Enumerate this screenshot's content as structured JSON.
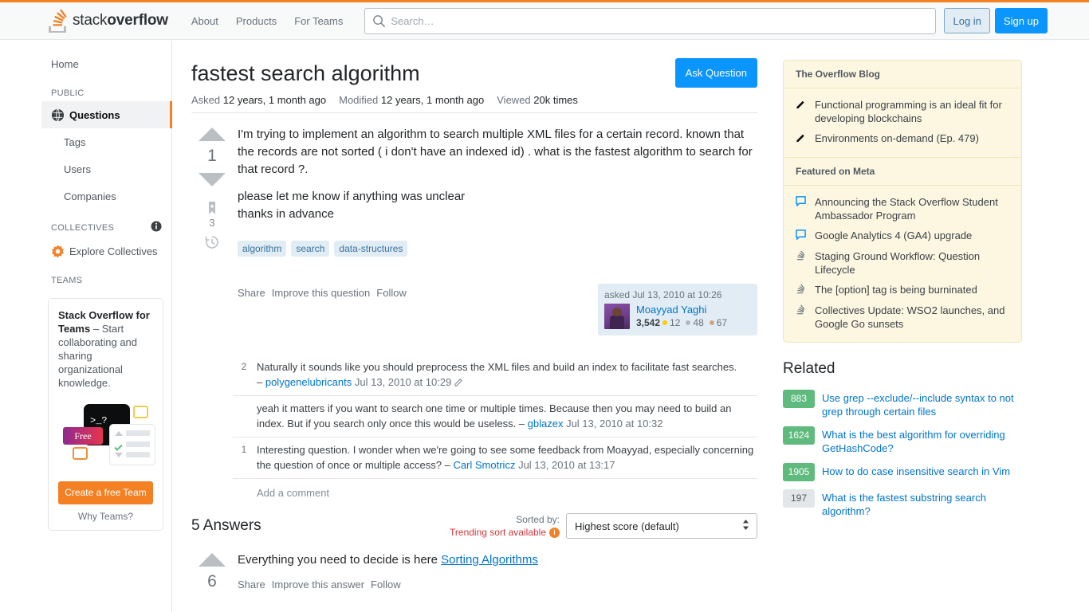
{
  "header": {
    "logo_text_1": "stack",
    "logo_text_2": "overflow",
    "nav": [
      {
        "label": "About"
      },
      {
        "label": "Products"
      },
      {
        "label": "For Teams"
      }
    ],
    "search_placeholder": "Search…",
    "search_value": "",
    "login_label": "Log in",
    "signup_label": "Sign up"
  },
  "left_rail": {
    "home_label": "Home",
    "public_heading": "PUBLIC",
    "public_items": [
      {
        "label": "Questions",
        "icon": "globe-icon",
        "selected": true
      },
      {
        "label": "Tags",
        "icon": "",
        "selected": false
      },
      {
        "label": "Users",
        "icon": "",
        "selected": false
      },
      {
        "label": "Companies",
        "icon": "",
        "selected": false
      }
    ],
    "collectives_heading": "COLLECTIVES",
    "explore_collectives_label": "Explore Collectives",
    "teams_heading": "TEAMS",
    "promo": {
      "title": "Stack Overflow for Teams",
      "body": " – Start collaborating and sharing organizational knowledge.",
      "free_badge": "Free",
      "terminal_text": ">_?",
      "cta_label": "Create a free Team",
      "why_label": "Why Teams?"
    }
  },
  "question": {
    "title": "fastest search algorithm",
    "asked_label": "Asked",
    "asked_value": "12 years, 1 month ago",
    "modified_label": "Modified",
    "modified_value": "12 years, 1 month ago",
    "viewed_label": "Viewed",
    "viewed_value": "20k times",
    "ask_question_label": "Ask Question",
    "vote_score": "1",
    "bookmark_count": "3",
    "body_paragraph_1": "I'm trying to implement an algorithm to search multiple XML files for a certain record. known that the records are not sorted ( i don't have an indexed id) . what is the fastest algorithm to search for that record ?.",
    "body_paragraph_2": "please let me know if anything was unclear",
    "body_paragraph_3": "thanks in advance",
    "tags": [
      "algorithm",
      "search",
      "data-structures"
    ],
    "actions": [
      "Share",
      "Improve this question",
      "Follow"
    ],
    "usercard": {
      "date": "asked Jul 13, 2010 at 10:26",
      "name": "Moayyad Yaghi",
      "reputation": "3,542",
      "gold": "12",
      "silver": "48",
      "bronze": "67"
    },
    "comments": [
      {
        "score": "2",
        "text": "Naturally it sounds like you should preprocess the XML files and build an index to facilitate fast searches.",
        "dash": "– ",
        "user": "polygenelubricants",
        "date": " Jul 13, 2010 at 10:29",
        "has_edit_icon": true,
        "user_position": "start"
      },
      {
        "score": "",
        "text": "yeah it matters if you want to search one time or multiple times. Because then you may need to build an index. But if you search only once this would be useless. – ",
        "dash": "",
        "user": "gblazex",
        "date": " Jul 13, 2010 at 10:32",
        "has_edit_icon": false,
        "user_position": "inline"
      },
      {
        "score": "1",
        "text": "Interesting question. I wonder when we're going to see some feedback from Moayyad, especially concerning the question of once or multiple access? – ",
        "dash": "",
        "user": "Carl Smotricz",
        "date": " Jul 13, 2010 at 13:17",
        "has_edit_icon": false,
        "user_position": "inline"
      }
    ],
    "add_comment_label": "Add a comment"
  },
  "answers": {
    "count_label": "5 Answers",
    "sorted_by_label": "Sorted by:",
    "trending_label": "Trending sort available",
    "sort_value": "Highest score (default)",
    "first_answer": {
      "score": "6",
      "text_before_link": "Everything you need to decide is here ",
      "link_text": "Sorting Algorithms",
      "actions": [
        "Share",
        "Improve this answer",
        "Follow"
      ]
    }
  },
  "right_rail": {
    "blog_title": "The Overflow Blog",
    "blog_items": [
      {
        "label": "Functional programming is an ideal fit for developing blockchains",
        "icon": "pencil-icon"
      },
      {
        "label": "Environments on-demand (Ep. 479)",
        "icon": "pencil-icon"
      }
    ],
    "meta_title": "Featured on Meta",
    "meta_items": [
      {
        "label": "Announcing the Stack Overflow Student Ambassador Program",
        "icon": "speech-bubble-icon"
      },
      {
        "label": "Google Analytics 4 (GA4) upgrade",
        "icon": "speech-bubble-icon"
      },
      {
        "label": "Staging Ground Workflow: Question Lifecycle",
        "icon": "stacks-icon"
      },
      {
        "label": "The [option] tag is being burninated",
        "icon": "stacks-icon"
      },
      {
        "label": "Collectives Update: WSO2 launches, and Google Go sunsets",
        "icon": "stacks-icon"
      }
    ],
    "related_title": "Related",
    "related_items": [
      {
        "score": "883",
        "label": "Use grep --exclude/--include syntax to not grep through certain files",
        "answered": true
      },
      {
        "score": "1624",
        "label": "What is the best algorithm for overriding GetHashCode?",
        "answered": true
      },
      {
        "score": "1905",
        "label": "How to do case insensitive search in Vim",
        "answered": true
      },
      {
        "score": "197",
        "label": "What is the fastest substring search algorithm?",
        "answered": false
      }
    ]
  },
  "colors": {
    "orange": "#f48024",
    "blue": "#0a95ff",
    "link_blue": "#0074cc",
    "green": "#5eba7d",
    "cream": "#fdf7e2"
  }
}
